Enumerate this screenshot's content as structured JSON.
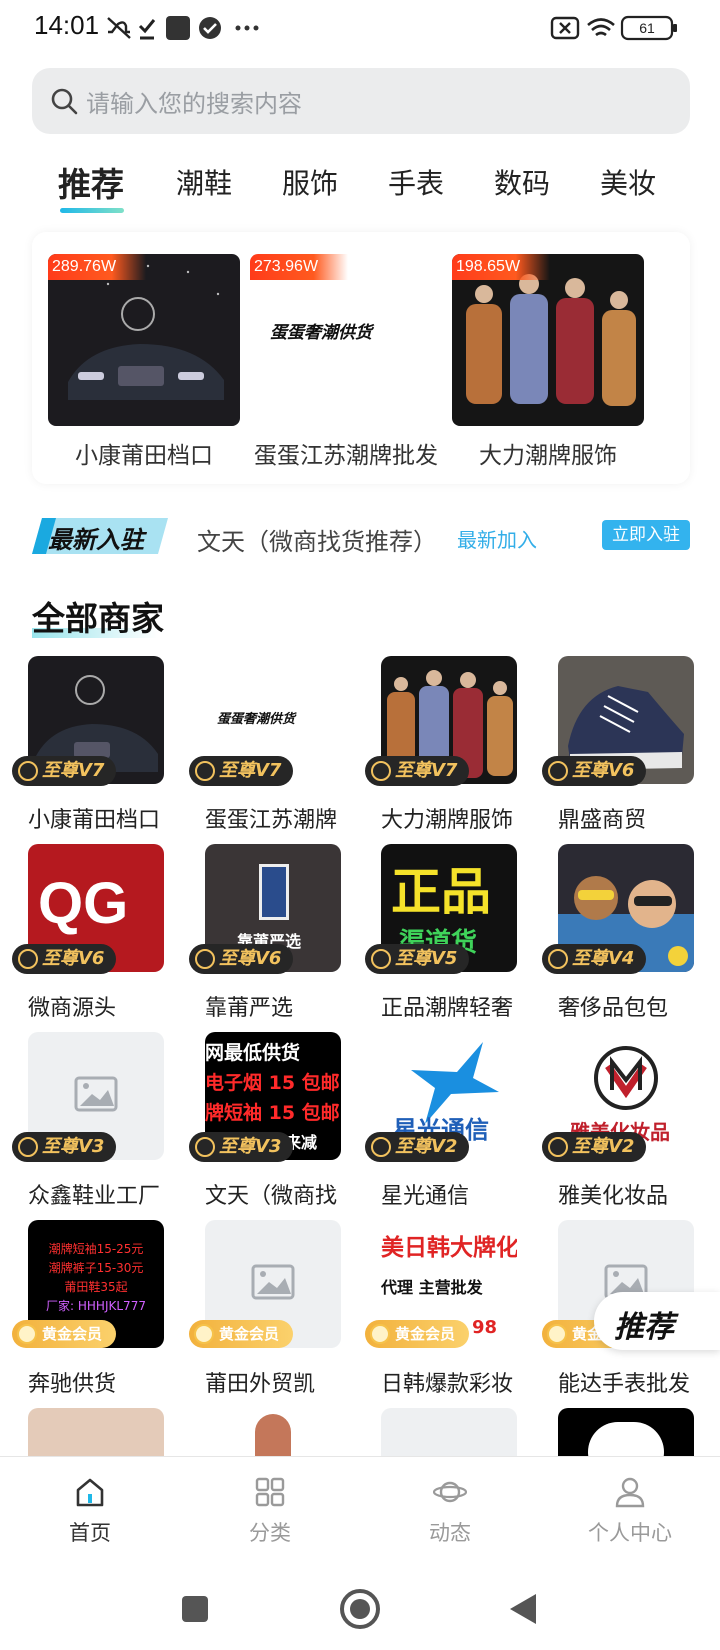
{
  "status_bar": {
    "time": "14:01",
    "battery": "61"
  },
  "search": {
    "placeholder": "请输入您的搜索内容"
  },
  "tabs": [
    {
      "label": "推荐",
      "active": true
    },
    {
      "label": "潮鞋"
    },
    {
      "label": "服饰"
    },
    {
      "label": "手表"
    },
    {
      "label": "数码"
    },
    {
      "label": "美妆"
    }
  ],
  "featured": [
    {
      "name": "小康莆田档口",
      "heat": "289.76W"
    },
    {
      "name": "蛋蛋江苏潮牌批发",
      "heat": "273.96W",
      "logo_text": "蛋蛋奢潮供货"
    },
    {
      "name": "大力潮牌服饰",
      "heat": "198.65W"
    }
  ],
  "newest": {
    "tag": "最新入驻",
    "merchant": "文天（微商找货推荐）",
    "link": "最新加入",
    "button": "立即入驻"
  },
  "section_title": "全部商家",
  "merchants": [
    {
      "name": "小康莆田档口",
      "badge": "至尊V7",
      "badge_type": "vip"
    },
    {
      "name": "蛋蛋江苏潮牌",
      "badge": "至尊V7",
      "badge_type": "vip",
      "logo_text": "蛋蛋奢潮供货"
    },
    {
      "name": "大力潮牌服饰",
      "badge": "至尊V7",
      "badge_type": "vip"
    },
    {
      "name": "鼎盛商贸",
      "badge": "至尊V6",
      "badge_type": "vip"
    },
    {
      "name": "微商源头",
      "badge": "至尊V6",
      "badge_type": "vip",
      "logo_text": "QG"
    },
    {
      "name": "靠莆严选",
      "badge": "至尊V6",
      "badge_type": "vip",
      "logo_text": "靠莆严选"
    },
    {
      "name": "正品潮牌轻奢",
      "badge": "至尊V5",
      "badge_type": "vip",
      "logo_text": "正品",
      "logo_sub": "渠道货"
    },
    {
      "name": "奢侈品包包",
      "badge": "至尊V4",
      "badge_type": "vip"
    },
    {
      "name": "众鑫鞋业工厂",
      "badge": "至尊V3",
      "badge_type": "vip"
    },
    {
      "name": "文天（微商找",
      "badge": "至尊V3",
      "badge_type": "vip",
      "logo_lines": [
        "网最低供货",
        "电子烟 15 包邮",
        "牌短袖 15 包邮",
        "带外面价格来减"
      ]
    },
    {
      "name": "星光通信",
      "badge": "至尊V2",
      "badge_type": "vip",
      "logo_text": "星光通信"
    },
    {
      "name": "雅美化妆品",
      "badge": "至尊V2",
      "badge_type": "vip",
      "logo_text": "雅美化妆品"
    },
    {
      "name": "奔驰供货",
      "badge": "黄金会员",
      "badge_type": "gold",
      "logo_lines": [
        "潮牌短袖15-25元",
        "潮牌裤子15-30元",
        "莆田鞋35起",
        "厂家: HHHJKL777"
      ]
    },
    {
      "name": "莆田外贸凯",
      "badge": "黄金会员",
      "badge_type": "gold"
    },
    {
      "name": "日韩爆款彩妆",
      "badge": "黄金会员",
      "badge_type": "gold",
      "logo_lines": [
        "美日韩大牌化",
        "代理  主营批发",
        "98"
      ]
    },
    {
      "name": "能达手表批发",
      "badge": "黄金会员",
      "badge_type": "gold"
    }
  ],
  "float_button": "推荐",
  "bottom_nav": [
    {
      "label": "首页",
      "icon": "home-icon",
      "active": true
    },
    {
      "label": "分类",
      "icon": "category-icon"
    },
    {
      "label": "动态",
      "icon": "planet-icon"
    },
    {
      "label": "个人中心",
      "icon": "user-icon"
    }
  ],
  "colors": {
    "accent": "#33b3ee",
    "vip_badge_bg": "#262626",
    "vip_badge_text": "#f2c25e",
    "heat_badge": "#ff3b1a"
  }
}
